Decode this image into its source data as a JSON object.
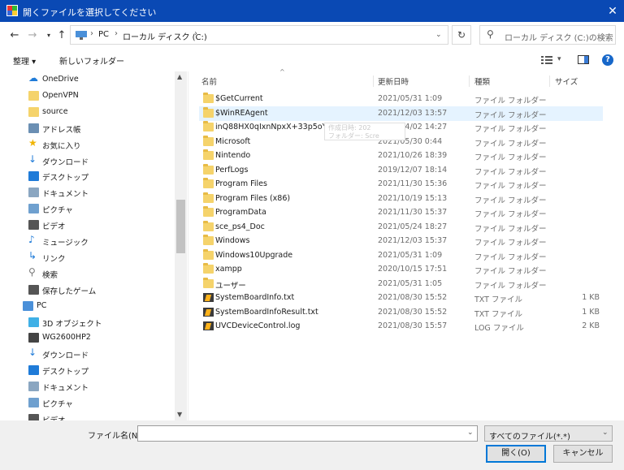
{
  "window": {
    "title": "開くファイルを選択してください",
    "close_icon": "close-icon"
  },
  "address": {
    "crumbs": [
      "PC",
      "ローカル ディスク (C:)"
    ],
    "search_placeholder": "ローカル ディスク (C:)の検索"
  },
  "toolbar": {
    "organize": "整理 ▾",
    "new_folder": "新しいフォルダー"
  },
  "nav": [
    {
      "label": "OneDrive",
      "icon": "cloud-icon"
    },
    {
      "label": "OpenVPN",
      "icon": "folder-icon"
    },
    {
      "label": "source",
      "icon": "folder-icon"
    },
    {
      "label": "アドレス帳",
      "icon": "contacts-icon"
    },
    {
      "label": "お気に入り",
      "icon": "star-icon"
    },
    {
      "label": "ダウンロード",
      "icon": "download-icon"
    },
    {
      "label": "デスクトップ",
      "icon": "desktop-icon"
    },
    {
      "label": "ドキュメント",
      "icon": "document-icon"
    },
    {
      "label": "ピクチャ",
      "icon": "picture-icon"
    },
    {
      "label": "ビデオ",
      "icon": "video-icon"
    },
    {
      "label": "ミュージック",
      "icon": "music-icon"
    },
    {
      "label": "リンク",
      "icon": "link-icon"
    },
    {
      "label": "検索",
      "icon": "search-icon"
    },
    {
      "label": "保存したゲーム",
      "icon": "games-icon"
    },
    {
      "label": "PC",
      "icon": "pc-icon"
    },
    {
      "label": "3D オブジェクト",
      "icon": "cube-icon"
    },
    {
      "label": "WG2600HP2",
      "icon": "device-icon"
    },
    {
      "label": "ダウンロード",
      "icon": "download-icon"
    },
    {
      "label": "デスクトップ",
      "icon": "desktop-icon"
    },
    {
      "label": "ドキュメント",
      "icon": "document-icon"
    },
    {
      "label": "ピクチャ",
      "icon": "picture-icon"
    },
    {
      "label": "ビデオ",
      "icon": "video-icon"
    }
  ],
  "columns": {
    "name": "名前",
    "date": "更新日時",
    "type": "種類",
    "size": "サイズ"
  },
  "files": [
    {
      "name": "$GetCurrent",
      "date": "2021/05/31 1:09",
      "type": "ファイル フォルダー",
      "size": "",
      "kind": "folder"
    },
    {
      "name": "$WinREAgent",
      "date": "2021/12/03 13:57",
      "type": "ファイル フォルダー",
      "size": "",
      "kind": "folder"
    },
    {
      "name": "inQ88HX0qIxnNpxX+33p5oY4ls=",
      "date": "2021/04/02 14:27",
      "type": "ファイル フォルダー",
      "size": "",
      "kind": "folder"
    },
    {
      "name": "Microsoft",
      "date": "2021/05/30 0:44",
      "type": "ファイル フォルダー",
      "size": "",
      "kind": "folder"
    },
    {
      "name": "Nintendo",
      "date": "2021/10/26 18:39",
      "type": "ファイル フォルダー",
      "size": "",
      "kind": "folder"
    },
    {
      "name": "PerfLogs",
      "date": "2019/12/07 18:14",
      "type": "ファイル フォルダー",
      "size": "",
      "kind": "folder"
    },
    {
      "name": "Program Files",
      "date": "2021/11/30 15:36",
      "type": "ファイル フォルダー",
      "size": "",
      "kind": "folder"
    },
    {
      "name": "Program Files (x86)",
      "date": "2021/10/19 15:13",
      "type": "ファイル フォルダー",
      "size": "",
      "kind": "folder"
    },
    {
      "name": "ProgramData",
      "date": "2021/11/30 15:37",
      "type": "ファイル フォルダー",
      "size": "",
      "kind": "folder"
    },
    {
      "name": "sce_ps4_Doc",
      "date": "2021/05/24 18:27",
      "type": "ファイル フォルダー",
      "size": "",
      "kind": "folder"
    },
    {
      "name": "Windows",
      "date": "2021/12/03 15:37",
      "type": "ファイル フォルダー",
      "size": "",
      "kind": "folder"
    },
    {
      "name": "Windows10Upgrade",
      "date": "2021/05/31 1:09",
      "type": "ファイル フォルダー",
      "size": "",
      "kind": "folder"
    },
    {
      "name": "xampp",
      "date": "2020/10/15 17:51",
      "type": "ファイル フォルダー",
      "size": "",
      "kind": "folder"
    },
    {
      "name": "ユーザー",
      "date": "2021/05/31 1:05",
      "type": "ファイル フォルダー",
      "size": "",
      "kind": "folder"
    },
    {
      "name": "SystemBoardInfo.txt",
      "date": "2021/08/30 15:52",
      "type": "TXT ファイル",
      "size": "1 KB",
      "kind": "txt"
    },
    {
      "name": "SystemBoardInfoResult.txt",
      "date": "2021/08/30 15:52",
      "type": "TXT ファイル",
      "size": "1 KB",
      "kind": "txt"
    },
    {
      "name": "UVCDeviceControl.log",
      "date": "2021/08/30 15:57",
      "type": "LOG ファイル",
      "size": "2 KB",
      "kind": "txt"
    }
  ],
  "tooltip": {
    "line1": "作成日時: 202",
    "line2": "フォルダー: Scre"
  },
  "bottom": {
    "filename_label": "ファイル名(N):",
    "filename_value": "",
    "filter_value": "すべてのファイル(*.*)",
    "open_label": "開く(O)",
    "cancel_label": "キャンセル"
  }
}
